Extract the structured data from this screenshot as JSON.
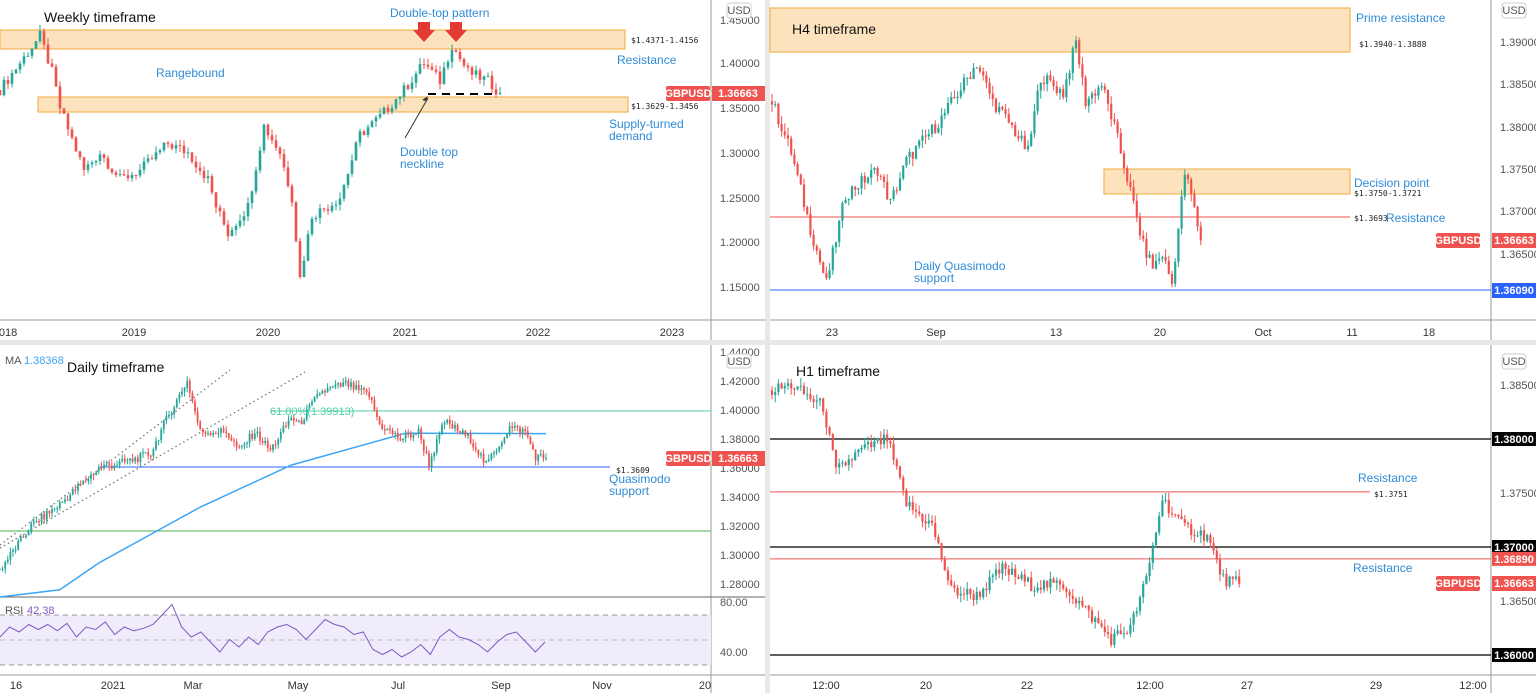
{
  "symbol": "GBPUSD",
  "currency": "USD",
  "last_price": "1.36663",
  "colors": {
    "up": "#26a69a",
    "down": "#ef5350",
    "annotation": "#2f8bd6",
    "zone_fill": "#fde3bd",
    "zone_border": "#f2a93b",
    "ma": "#3da5f4",
    "rsi": "#7e57c2",
    "fib": "#4fd1a5"
  },
  "chart_data": [
    {
      "type": "candlestick",
      "title": "Weekly timeframe",
      "x_ticks": [
        "2018",
        "2019",
        "2020",
        "2021",
        "2022",
        "2023"
      ],
      "y_ticks": [
        "1.45000",
        "1.40000",
        "1.35000",
        "1.30000",
        "1.25000",
        "1.20000",
        "1.15000"
      ],
      "ylim": [
        1.11,
        1.47
      ],
      "keypoints": [
        [
          0,
          1.37
        ],
        [
          5,
          1.4
        ],
        [
          10,
          1.43
        ],
        [
          13,
          1.39
        ],
        [
          15,
          1.35
        ],
        [
          21,
          1.28
        ],
        [
          25,
          1.3
        ],
        [
          30,
          1.27
        ],
        [
          35,
          1.28
        ],
        [
          42,
          1.31
        ],
        [
          47,
          1.3
        ],
        [
          52,
          1.27
        ],
        [
          54,
          1.24
        ],
        [
          57,
          1.21
        ],
        [
          62,
          1.24
        ],
        [
          66,
          1.33
        ],
        [
          70,
          1.3
        ],
        [
          73,
          1.25
        ],
        [
          75,
          1.16
        ],
        [
          78,
          1.23
        ],
        [
          82,
          1.24
        ],
        [
          85,
          1.25
        ],
        [
          90,
          1.32
        ],
        [
          95,
          1.34
        ],
        [
          101,
          1.37
        ],
        [
          106,
          1.4
        ],
        [
          110,
          1.38
        ],
        [
          113,
          1.42
        ],
        [
          117,
          1.39
        ],
        [
          122,
          1.38
        ],
        [
          125,
          1.3666
        ]
      ],
      "zones": [
        {
          "from": 1.4156,
          "to": 1.4371,
          "label": "$1.4371-1.4156"
        },
        {
          "from": 1.3456,
          "to": 1.3629,
          "label": "$1.3629-1.3456"
        }
      ],
      "annotations": {
        "pattern": "Double-top pattern",
        "resistance": "Resistance",
        "range": "Rangebound",
        "demand_1": "Supply-turned",
        "demand_2": "demand",
        "neckline_1": "Double top",
        "neckline_2": "neckline"
      },
      "neckline_price": 1.3665
    },
    {
      "type": "candlestick",
      "title": "H4 timeframe",
      "x_ticks": [
        "23",
        "Sep",
        "13",
        "20",
        "Oct",
        "11",
        "18"
      ],
      "y_ticks": [
        "1.39000",
        "1.38500",
        "1.38000",
        "1.37500",
        "1.37000",
        "1.36500"
      ],
      "keypoints": [
        [
          0,
          1.383
        ],
        [
          6,
          1.377
        ],
        [
          12,
          1.368
        ],
        [
          17,
          1.3615
        ],
        [
          23,
          1.372
        ],
        [
          33,
          1.375
        ],
        [
          37,
          1.371
        ],
        [
          42,
          1.376
        ],
        [
          53,
          1.381
        ],
        [
          64,
          1.3875
        ],
        [
          69,
          1.383
        ],
        [
          75,
          1.38
        ],
        [
          80,
          1.377
        ],
        [
          84,
          1.386
        ],
        [
          91,
          1.384
        ],
        [
          95,
          1.39
        ],
        [
          98,
          1.383
        ],
        [
          103,
          1.385
        ],
        [
          107,
          1.38
        ],
        [
          111,
          1.374
        ],
        [
          116,
          1.366
        ],
        [
          119,
          1.3635
        ],
        [
          122,
          1.365
        ],
        [
          125,
          1.3615
        ],
        [
          129,
          1.3745
        ],
        [
          131,
          1.372
        ],
        [
          134,
          1.3666
        ]
      ],
      "zones": [
        {
          "from": 1.3888,
          "to": 1.394,
          "label": "$1.3940-1.3888"
        },
        {
          "from": 1.3721,
          "to": 1.375,
          "label": "$1.3750-1.3721"
        }
      ],
      "levels": [
        {
          "price": 1.3693,
          "label": "$1.3693"
        },
        {
          "price": 1.3609,
          "label": "1.36090"
        }
      ],
      "annotations": {
        "prime": "Prime resistance",
        "decision": "Decision point",
        "resistance": "Resistance",
        "qm_1": "Daily Quasimodo",
        "qm_2": "support"
      }
    },
    {
      "type": "candlestick",
      "title": "Daily timeframe",
      "ma_label": "MA",
      "ma_value": "1.38368",
      "x_ticks": [
        "16",
        "2021",
        "Mar",
        "May",
        "Jul",
        "Sep",
        "Nov",
        "20"
      ],
      "y_ticks": [
        "1.44000",
        "1.42000",
        "1.40000",
        "1.38000",
        "1.36000",
        "1.34000",
        "1.32000",
        "1.30000",
        "1.28000"
      ],
      "keypoints": [
        [
          0,
          1.29
        ],
        [
          12,
          1.32
        ],
        [
          23,
          1.335
        ],
        [
          38,
          1.36
        ],
        [
          50,
          1.365
        ],
        [
          58,
          1.37
        ],
        [
          63,
          1.39
        ],
        [
          72,
          1.42
        ],
        [
          77,
          1.385
        ],
        [
          87,
          1.385
        ],
        [
          92,
          1.372
        ],
        [
          98,
          1.385
        ],
        [
          104,
          1.372
        ],
        [
          112,
          1.395
        ],
        [
          115,
          1.39
        ],
        [
          123,
          1.412
        ],
        [
          133,
          1.418
        ],
        [
          142,
          1.41
        ],
        [
          146,
          1.39
        ],
        [
          154,
          1.38
        ],
        [
          161,
          1.385
        ],
        [
          165,
          1.363
        ],
        [
          171,
          1.392
        ],
        [
          181,
          1.38
        ],
        [
          187,
          1.362
        ],
        [
          196,
          1.388
        ],
        [
          202,
          1.385
        ],
        [
          206,
          1.368
        ],
        [
          210,
          1.3666
        ]
      ],
      "ma": [
        [
          0,
          1.271
        ],
        [
          23,
          1.276
        ],
        [
          38,
          1.2945
        ],
        [
          77,
          1.333
        ],
        [
          112,
          1.362
        ],
        [
          156,
          1.384
        ],
        [
          210,
          1.3837
        ]
      ],
      "fib": {
        "price": 1.39913,
        "label": "61.80%(1.39913)"
      },
      "green_level": 1.3166,
      "qm": {
        "price": 1.3609,
        "label": "$1.3609",
        "text_1": "Quasimodo",
        "text_2": "support"
      },
      "rsi": {
        "label": "RSI",
        "value": "42.38",
        "ticks": [
          "80.00",
          "40.00"
        ],
        "values": [
          52,
          60,
          56,
          62,
          58,
          62,
          57,
          63,
          52,
          60,
          58,
          64,
          54,
          60,
          57,
          59,
          62,
          70,
          78,
          60,
          52,
          56,
          48,
          40,
          50,
          44,
          52,
          46,
          56,
          60,
          62,
          58,
          50,
          58,
          66,
          62,
          60,
          54,
          56,
          42,
          38,
          42,
          36,
          40,
          46,
          38,
          52,
          58,
          52,
          50,
          46,
          40,
          48,
          54,
          56,
          48,
          40,
          48
        ]
      }
    },
    {
      "type": "candlestick",
      "title": "H1 timeframe",
      "x_ticks": [
        "12:00",
        "20",
        "22",
        "12:00",
        "27",
        "29",
        "12:00"
      ],
      "y_ticks": [
        "1.38500",
        "1.37500",
        "1.36500"
      ],
      "keypoints": [
        [
          0,
          1.3845
        ],
        [
          6,
          1.385
        ],
        [
          16,
          1.383
        ],
        [
          20,
          1.377
        ],
        [
          28,
          1.379
        ],
        [
          36,
          1.38
        ],
        [
          42,
          1.374
        ],
        [
          50,
          1.372
        ],
        [
          56,
          1.366
        ],
        [
          64,
          1.3655
        ],
        [
          72,
          1.368
        ],
        [
          81,
          1.3665
        ],
        [
          91,
          1.3665
        ],
        [
          100,
          1.3635
        ],
        [
          106,
          1.3615
        ],
        [
          112,
          1.3625
        ],
        [
          117,
          1.367
        ],
        [
          122,
          1.3745
        ],
        [
          128,
          1.372
        ],
        [
          136,
          1.371
        ],
        [
          141,
          1.367
        ],
        [
          146,
          1.3666
        ]
      ],
      "levels": [
        {
          "price": 1.38,
          "label": "1.38000",
          "color": "#000000"
        },
        {
          "price": 1.3751,
          "label": "$1.3751",
          "color": "#ef5350"
        },
        {
          "price": 1.37,
          "label": "1.37000",
          "color": "#000000"
        },
        {
          "price": 1.3689,
          "label": "1.36890",
          "color": "#ef5350"
        },
        {
          "price": 1.36,
          "label": "1.36000",
          "color": "#000000"
        }
      ],
      "annotations": {
        "resistance_upper": "Resistance",
        "resistance_lower": "Resistance"
      }
    }
  ]
}
